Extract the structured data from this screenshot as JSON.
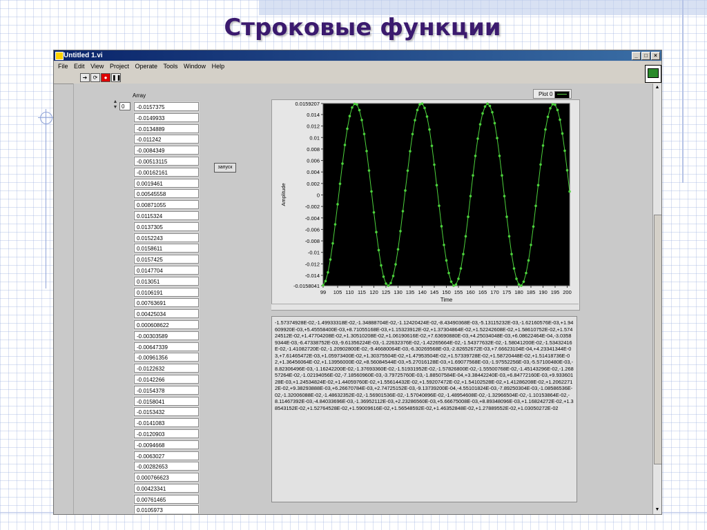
{
  "slide": {
    "title": "Строковые функции"
  },
  "window": {
    "title": "Untitled 1.vi",
    "buttons": [
      "_",
      "□",
      "×"
    ],
    "menu": [
      "File",
      "Edit",
      "View",
      "Project",
      "Operate",
      "Tools",
      "Window",
      "Help"
    ]
  },
  "array": {
    "label": "Array",
    "index": "0",
    "values": [
      "-0.0157375",
      "-0.0149933",
      "-0.0134889",
      "-0.011242",
      "-0.0084349",
      "-0.00513115",
      "-0.00162161",
      "0.0019461",
      "0.00545558",
      "0.00871055",
      "0.0115324",
      "0.0137305",
      "0.0152243",
      "0.0158611",
      "0.0157425",
      "0.0147704",
      "0.013051",
      "0.0106191",
      "0.00763691",
      "0.00425034",
      "0.000608622",
      "-0.00303589",
      "-0.00647339",
      "-0.00961356",
      "-0.0122632",
      "-0.0142266",
      "-0.0154378",
      "-0.0158041",
      "-0.0153432",
      "-0.0141083",
      "-0.0120903",
      "-0.0094668",
      "-0.0063027",
      "-0.00282653",
      "0.000766623",
      "0.00423341",
      "0.00761465",
      "0.0105973"
    ]
  },
  "run_button": {
    "label": "запуск"
  },
  "legend": {
    "label": "Plot 0"
  },
  "colors": {
    "plot_line": "#4cd23c",
    "plot_bg": "#000000"
  },
  "chart_data": {
    "type": "line",
    "x_label": "Time",
    "y_label": "Amplitude",
    "xlim": [
      99,
      201
    ],
    "ylim": [
      -0.0158041,
      0.0159207
    ],
    "x_ticks": [
      "99",
      "105",
      "110",
      "115",
      "120",
      "125",
      "130",
      "135",
      "140",
      "145",
      "150",
      "155",
      "160",
      "165",
      "170",
      "175",
      "180",
      "185",
      "190",
      "195",
      "200"
    ],
    "y_ticks": [
      "0.0159207",
      "0.014",
      "0.012",
      "0.01",
      "0.008",
      "0.006",
      "0.004",
      "0.002",
      "0",
      "-0.002",
      "-0.004",
      "-0.006",
      "-0.008",
      "-0.01",
      "-0.012",
      "-0.014",
      "-0.0158041"
    ],
    "series": [
      {
        "x_start": 99,
        "x_step": 1,
        "values": [
          -0.0157375,
          -0.0149933,
          -0.0134889,
          -0.011242,
          -0.0084349,
          -0.00513115,
          -0.00162161,
          0.0019461,
          0.00545558,
          0.00871055,
          0.0115324,
          0.0137305,
          0.0152243,
          0.0158611,
          0.0157425,
          0.0147704,
          0.013051,
          0.0106191,
          0.00763691,
          0.00425034,
          0.000608622,
          -0.00303589,
          -0.00647339,
          -0.00961356,
          -0.0122632,
          -0.0142266,
          -0.0154378,
          -0.0158041,
          -0.0153432,
          -0.0141083,
          -0.0120903,
          -0.0094668,
          -0.0063027,
          -0.00282653,
          0.000766623,
          0.00423341,
          0.00761465,
          0.0105973,
          0.0130208,
          0.0147882,
          0.0157736,
          0.0159,
          0.0151418,
          0.0136456,
          0.0113956,
          0.00856085,
          0.00527016,
          0.0017,
          -0.00188507,
          -0.00545,
          -0.0087,
          -0.0114,
          -0.0136,
          -0.0151,
          -0.0158,
          -0.0156,
          -0.0146,
          -0.0128,
          -0.0103,
          -0.0072,
          -0.0038,
          -0.0002,
          0.0034,
          0.0068,
          0.0098,
          0.0123,
          0.0142,
          0.0154,
          0.0159,
          0.0155,
          0.0144,
          0.0125,
          0.0099,
          0.0068,
          0.0034,
          -0.0002,
          -0.0038,
          -0.0072,
          -0.0103,
          -0.0128,
          -0.0146,
          -0.0156,
          -0.0158,
          -0.0151,
          -0.0136,
          -0.0114,
          -0.0087,
          -0.0055,
          -0.0019,
          0.0017,
          0.0053,
          0.0086,
          0.0114,
          0.0136,
          0.0151,
          0.0158,
          0.0157,
          0.0148,
          0.0131,
          0.0107,
          0.0077,
          0.0043,
          0.0006
        ]
      }
    ]
  },
  "text_output": "-1.57374928E-02,-1.49933318E-02,-1.34888704E-02,-1.12420424E-02,-8.43490368E-03,-5.13115232E-03,-1.62160576E-03,+1.94609920E-03,+5.45558400E-03,+8.71055168E-03,+1.15323912E-02,+1.37304864E-02,+1.52242608E-02,+1.58610752E-02,+1.57424512E-02,+1.47704208E-02,+1.30510208E-02,+1.06190616E-02,+7.63690880E-03,+4.25034048E-03,+6.08622464E-04,-3.03589344E-03,-6.47338752E-03,-9.61356224E-03,-1.22632376E-02,-1.42265664E-02,-1.54377632E-02,-1.58041200E-02,-1.53432416E-02,-1.41082720E-02,-1.20902800E-02,-9.46680064E-03,-6.30269568E-03,-2.82652672E-03,+7.66623104E-04,+4.23341344E-03,+7.61465472E-03,+1.05973400E-02,+1.30375504E-02,+1.47953504E-02,+1.57339728E-02,+1.58720448E-02,+1.51418736E-02,+1.36456064E-02,+1.13956000E-02,+8.56084544E-03,+5.27016128E-03,+1.69077568E-03,-1.97552256E-03,-5.57100480E-03,-8.82306496E-03,-1.16242200E-02,-1.37693360E-02,-1.51931952E-02,-1.57826800E-02,-1.55500768E-02,-1.45143296E-02,-1.26857264E-02,-1.02194056E-02,-7.18560960E-03,-3.79725760E-03,-1.88507584E-04,+3.38442240E-03,+6.84772160E-03,+9.93360128E-03,+1.24534824E-02,+1.44059760E-02,+1.55614432E-02,+1.59207472E-02,+1.54102528E-02,+1.41286208E-02,+1.20622712E-02,+9.38293888E-03,+6.26670784E-03,+2.74725152E-03,-9.13739200E-04,-4.55101824E-03,-7.89250304E-03,-1.08586536E-02,-1.32006088E-02,-1.48632352E-02,-1.56901536E-02,-1.57040896E-02,-1.48954608E-02,-1.32966504E-02,-1.10153864E-02,-8.11467392E-03,-4.84033696E-03,-1.36952112E-03,+2.23286560E-03,+5.66675008E-03,+8.89348096E-03,+1.16824272E-02,+1.38543152E-02,+1.52764528E-02,+1.59009616E-02,+1.56548592E-02,+1.46352848E-02,+1.27889552E-02,+1.03050272E-02"
}
